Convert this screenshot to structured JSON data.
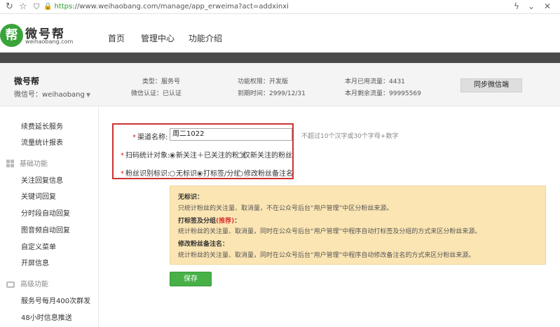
{
  "browser": {
    "url_scheme": "https",
    "url_rest": "://www.weihaobang.com/manage/app_erweima?act=addxinxi"
  },
  "header": {
    "logo_mark": "帮",
    "logo_text": "微号帮",
    "logo_sub": "weihaobang.com",
    "nav": [
      "首页",
      "管理中心",
      "功能介绍"
    ]
  },
  "account": {
    "name": "微号帮",
    "wechat_id": "微信号：weihaobang",
    "type": "类型：服务号",
    "verify": "微信认证：已认证",
    "permission": "功能权限：开发版",
    "expire": "到期时间：2999/12/31",
    "used": "本月已用流量：4431",
    "remaining": "本月剩余流量：99995569",
    "sync_button": "同步微信端"
  },
  "sidebar": {
    "top_items": [
      "续费延长服务",
      "流量统计报表"
    ],
    "group_basic": "基础功能",
    "basic_items": [
      "关注回复信息",
      "关键词回复",
      "分时段自动回复",
      "图音频自动回复",
      "自定义菜单",
      "开屏信息"
    ],
    "group_advanced": "高级功能",
    "advanced_items": [
      "服务号每月400次群发",
      "48小时信息推送"
    ]
  },
  "form": {
    "channel_label": "渠道名称:",
    "channel_value": "周二1022",
    "channel_hint": "不超过10个汉字或30个字母+数字",
    "scan_label": "扫码统计对象:",
    "scan_options": [
      "新关注＋已关注的粉丝",
      "仅新关注的粉丝"
    ],
    "scan_selected": 0,
    "fan_label": "粉丝识别标识:",
    "fan_options": [
      "无标识",
      "打标签/分组",
      "修改粉丝备注名"
    ],
    "fan_selected": 1
  },
  "panel": {
    "t1": "无标识：",
    "d1": "只统计粉丝的关注量、取消量，不在公众号后台“用户管理”中区分粉丝来源。",
    "t2": "打标签及分组",
    "t2_rec": "(推荐)",
    "t2_colon": "：",
    "d2": "统计粉丝的关注量、取消量，同时在公众号后台“用户管理”中程序自动打标签及分组的方式来区分粉丝来源。",
    "t3": "修改粉丝备注名：",
    "d3": "统计粉丝的关注量、取消量，同时在公众号后台“用户管理”中程序自动修改备注名的方式来区分粉丝来源。"
  },
  "save_button": "保存",
  "colors": {
    "brand_green": "#47b147",
    "highlight_red": "#cc3333",
    "panel_bg": "#fbe5b3"
  }
}
